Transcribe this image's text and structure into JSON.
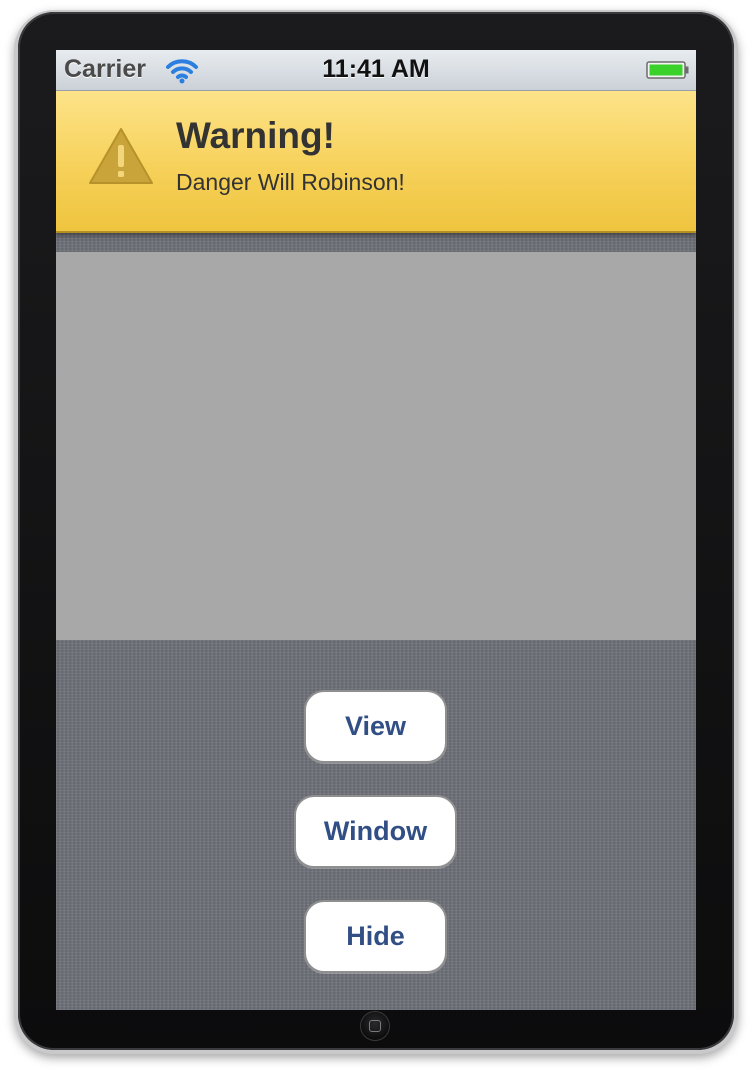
{
  "status_bar": {
    "carrier": "Carrier",
    "time": "11:41 AM",
    "wifi_icon": "wifi-icon",
    "battery_icon": "battery-full-icon",
    "battery_color": "#3ad12a"
  },
  "warning": {
    "icon": "warning-triangle-icon",
    "title": "Warning!",
    "message": "Danger Will Robinson!",
    "color": "#f6d15a"
  },
  "buttons": {
    "view": "View",
    "window": "Window",
    "hide": "Hide"
  },
  "colors": {
    "button_text": "#324f85",
    "gray_view": "#a8a8a8",
    "background": "#6d7078"
  }
}
